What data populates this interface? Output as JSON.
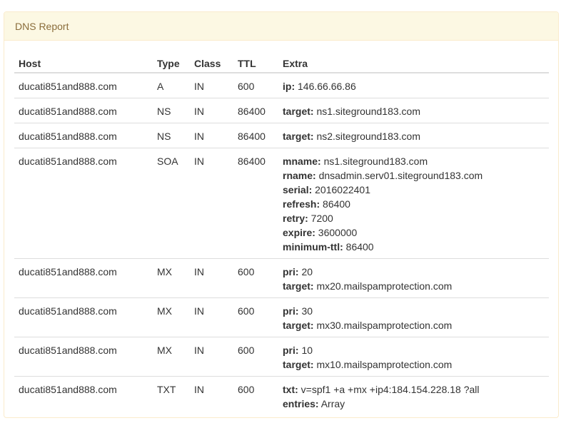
{
  "panel": {
    "title": "DNS Report"
  },
  "table": {
    "headers": [
      "Host",
      "Type",
      "Class",
      "TTL",
      "Extra"
    ],
    "rows": [
      {
        "host": "ducati851and888.com",
        "type": "A",
        "class": "IN",
        "ttl": "600",
        "extra": [
          {
            "key": "ip:",
            "value": " 146.66.66.86"
          }
        ]
      },
      {
        "host": "ducati851and888.com",
        "type": "NS",
        "class": "IN",
        "ttl": "86400",
        "extra": [
          {
            "key": "target:",
            "value": " ns1.siteground183.com"
          }
        ]
      },
      {
        "host": "ducati851and888.com",
        "type": "NS",
        "class": "IN",
        "ttl": "86400",
        "extra": [
          {
            "key": "target:",
            "value": " ns2.siteground183.com"
          }
        ]
      },
      {
        "host": "ducati851and888.com",
        "type": "SOA",
        "class": "IN",
        "ttl": "86400",
        "extra": [
          {
            "key": "mname:",
            "value": " ns1.siteground183.com"
          },
          {
            "key": "rname:",
            "value": " dnsadmin.serv01.siteground183.com"
          },
          {
            "key": "serial:",
            "value": " 2016022401"
          },
          {
            "key": "refresh:",
            "value": " 86400"
          },
          {
            "key": "retry:",
            "value": " 7200"
          },
          {
            "key": "expire:",
            "value": " 3600000"
          },
          {
            "key": "minimum-ttl:",
            "value": " 86400"
          }
        ]
      },
      {
        "host": "ducati851and888.com",
        "type": "MX",
        "class": "IN",
        "ttl": "600",
        "extra": [
          {
            "key": "pri:",
            "value": " 20"
          },
          {
            "key": "target:",
            "value": " mx20.mailspamprotection.com"
          }
        ]
      },
      {
        "host": "ducati851and888.com",
        "type": "MX",
        "class": "IN",
        "ttl": "600",
        "extra": [
          {
            "key": "pri:",
            "value": " 30"
          },
          {
            "key": "target:",
            "value": " mx30.mailspamprotection.com"
          }
        ]
      },
      {
        "host": "ducati851and888.com",
        "type": "MX",
        "class": "IN",
        "ttl": "600",
        "extra": [
          {
            "key": "pri:",
            "value": " 10"
          },
          {
            "key": "target:",
            "value": " mx10.mailspamprotection.com"
          }
        ]
      },
      {
        "host": "ducati851and888.com",
        "type": "TXT",
        "class": "IN",
        "ttl": "600",
        "extra": [
          {
            "key": "txt:",
            "value": " v=spf1 +a +mx +ip4:184.154.228.18 ?all"
          },
          {
            "key": "entries:",
            "value": " Array"
          }
        ]
      }
    ]
  },
  "colors": {
    "heading_bg": "#fcf8e3",
    "heading_border": "#faebcc",
    "heading_text": "#8a6d3b",
    "row_border": "#dddddd"
  }
}
